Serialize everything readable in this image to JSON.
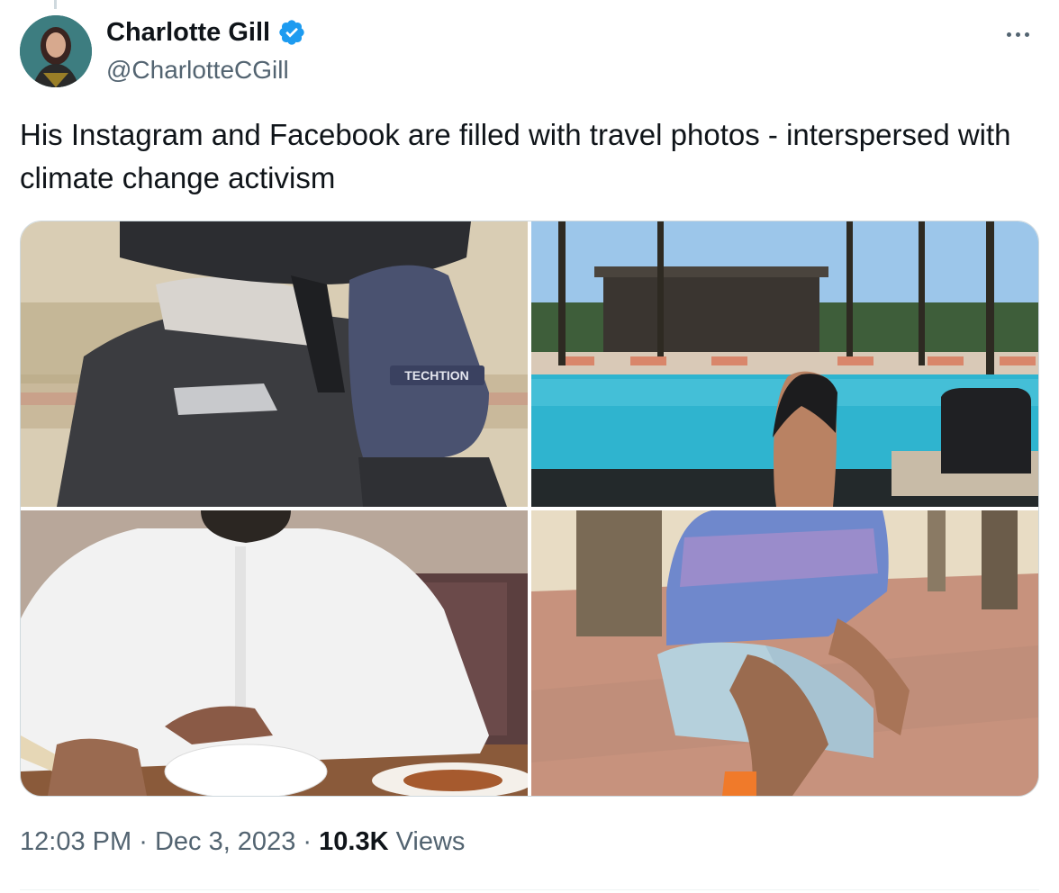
{
  "author": {
    "name": "Charlotte Gill",
    "handle": "@CharlotteCGill",
    "verified": true,
    "verified_color": "#1d9bf0"
  },
  "tweet": {
    "text": "His Instagram and Facebook are filled with travel photos - interspersed with climate change activism"
  },
  "media": [
    {
      "subject": "person in racing helmet and suit wearing a glove"
    },
    {
      "subject": "foot in flip-flop in front of a pool with palm trees"
    },
    {
      "subject": "person in white robe at a dinner table"
    },
    {
      "subject": "person in patterned shirt crouching on a palm-lined path"
    }
  ],
  "glove_brand": "TECHTION",
  "meta": {
    "time": "12:03 PM",
    "separator": "·",
    "date": "Dec 3, 2023",
    "views_count": "10.3K",
    "views_label": "Views"
  },
  "icons": {
    "more": "more-icon",
    "verified": "verified-badge-icon"
  }
}
